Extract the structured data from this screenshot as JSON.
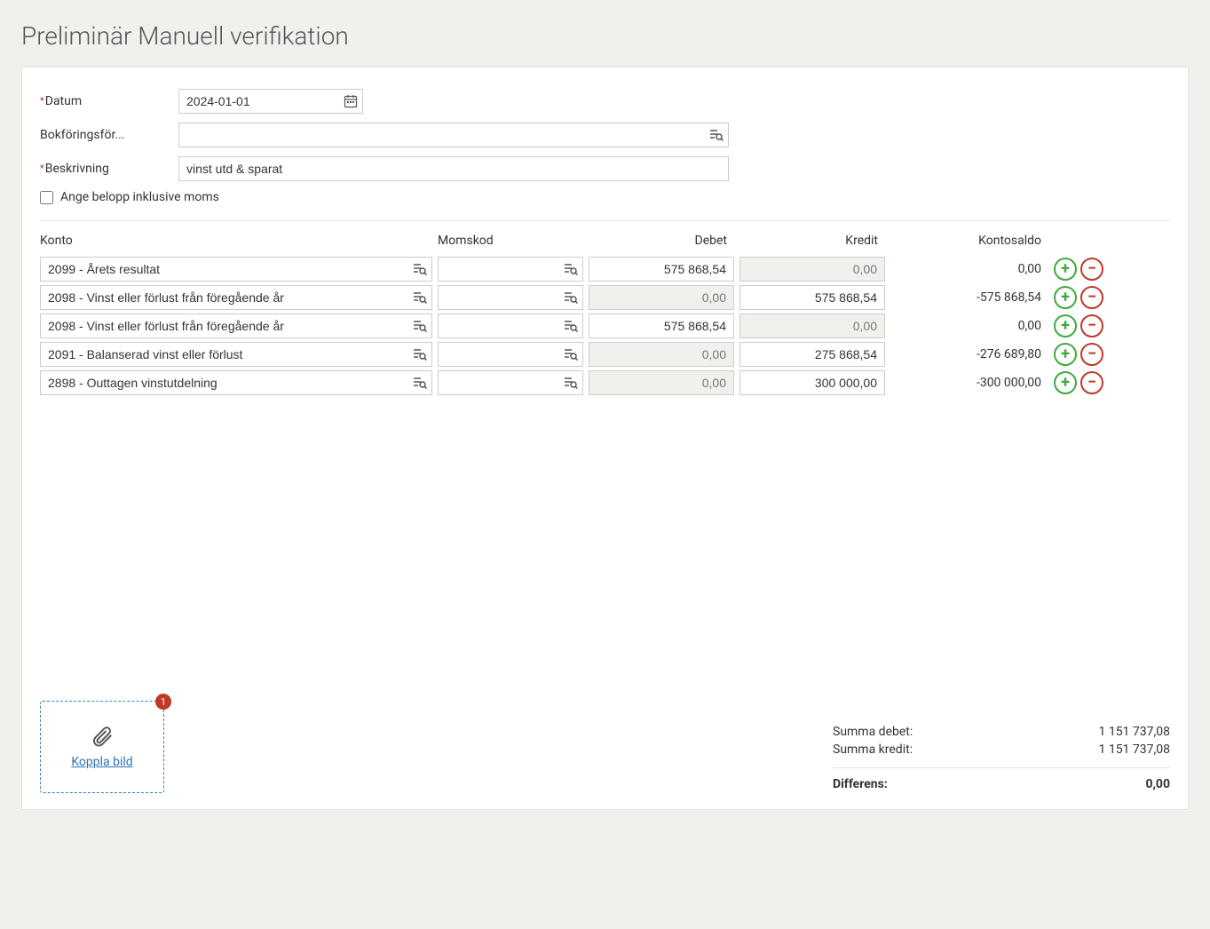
{
  "page": {
    "title": "Preliminär Manuell verifikation"
  },
  "form": {
    "date_label": "Datum",
    "date_value": "2024-01-01",
    "order_label": "Bokföringsför...",
    "order_value": "",
    "desc_label": "Beskrivning",
    "desc_value": "vinst utd & sparat",
    "vat_checkbox_label": "Ange belopp inklusive moms"
  },
  "columns": {
    "konto": "Konto",
    "momskod": "Momskod",
    "debet": "Debet",
    "kredit": "Kredit",
    "saldo": "Kontosaldo"
  },
  "rows": [
    {
      "konto": "2099 - Årets resultat",
      "momskod": "",
      "debet": "575 868,54",
      "kredit": "0,00",
      "saldo": "0,00",
      "debet_ro": false,
      "kredit_ro": true
    },
    {
      "konto": "2098 - Vinst eller förlust från föregående år",
      "momskod": "",
      "debet": "0,00",
      "kredit": "575 868,54",
      "saldo": "-575 868,54",
      "debet_ro": true,
      "kredit_ro": false
    },
    {
      "konto": "2098 - Vinst eller förlust från föregående år",
      "momskod": "",
      "debet": "575 868,54",
      "kredit": "0,00",
      "saldo": "0,00",
      "debet_ro": false,
      "kredit_ro": true
    },
    {
      "konto": "2091 - Balanserad vinst eller förlust",
      "momskod": "",
      "debet": "0,00",
      "kredit": "275 868,54",
      "saldo": "-276 689,80",
      "debet_ro": true,
      "kredit_ro": false
    },
    {
      "konto": "2898 - Outtagen vinstutdelning",
      "momskod": "",
      "debet": "0,00",
      "kredit": "300 000,00",
      "saldo": "-300 000,00",
      "debet_ro": true,
      "kredit_ro": false
    }
  ],
  "attach": {
    "label": "Koppla bild",
    "badge": "1"
  },
  "totals": {
    "debet_label": "Summa debet:",
    "debet_value": "1 151 737,08",
    "kredit_label": "Summa kredit:",
    "kredit_value": "1 151 737,08",
    "diff_label": "Differens:",
    "diff_value": "0,00"
  }
}
